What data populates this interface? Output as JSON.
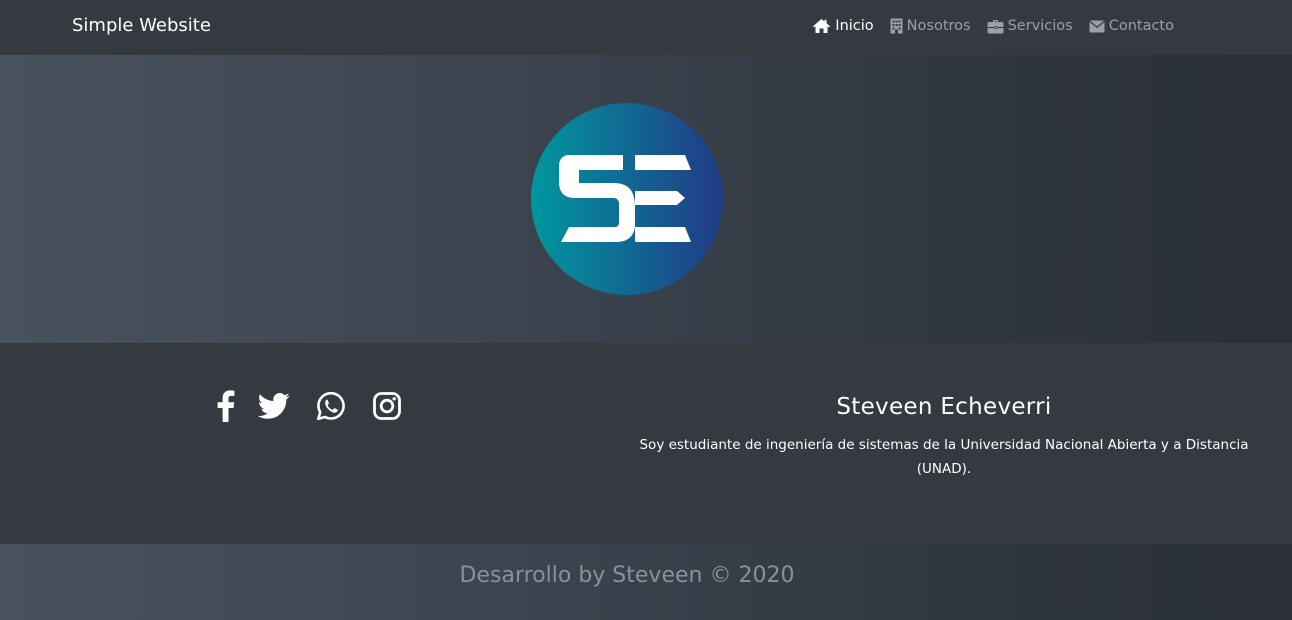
{
  "navbar": {
    "brand": "Simple Website",
    "items": [
      {
        "label": "Inicio",
        "icon": "home-icon",
        "active": true
      },
      {
        "label": "Nosotros",
        "icon": "building-icon",
        "active": false
      },
      {
        "label": "Servicios",
        "icon": "briefcase-icon",
        "active": false
      },
      {
        "label": "Contacto",
        "icon": "envelope-icon",
        "active": false
      }
    ]
  },
  "hero": {
    "logo_text": "SE",
    "logo_gradient": [
      "#00979f",
      "#213a86"
    ]
  },
  "socials": [
    {
      "icon": "facebook-icon"
    },
    {
      "icon": "twitter-icon"
    },
    {
      "icon": "whatsapp-icon"
    },
    {
      "icon": "instagram-icon"
    }
  ],
  "profile": {
    "name": "Steveen Echeverri",
    "description": "Soy estudiante de ingeniería de sistemas de la Universidad Nacional Abierta y a Distancia (UNAD)."
  },
  "footer": {
    "copyright": "Desarrollo by Steveen © 2020"
  },
  "colors": {
    "background": "#343a40",
    "nav_inactive": "#9aa0a6",
    "text": "#ffffff",
    "footer_text": "#8a9098"
  }
}
